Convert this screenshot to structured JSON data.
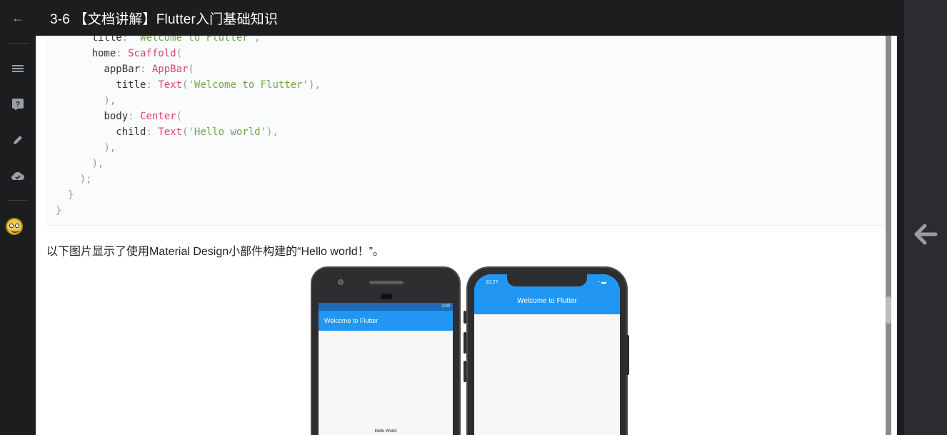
{
  "header": {
    "title": "3-6 【文档讲解】Flutter入门基础知识"
  },
  "left_rail": {
    "items": [
      {
        "name": "back-icon",
        "glyph": "←"
      },
      {
        "name": "menu-icon",
        "glyph": "≡"
      },
      {
        "name": "help-icon",
        "glyph": "?"
      },
      {
        "name": "edit-icon",
        "glyph": "✎"
      },
      {
        "name": "cloud-check-icon",
        "glyph": "☁"
      }
    ]
  },
  "code": {
    "lines": [
      {
        "indent": "      ",
        "key": "title",
        "colon": ": ",
        "str": "'Welcome to Flutter'",
        "tail": ","
      },
      {
        "indent": "      ",
        "key": "home",
        "colon": ": ",
        "type": "Scaffold",
        "tail": "("
      },
      {
        "indent": "        ",
        "key": "appBar",
        "colon": ": ",
        "type": "AppBar",
        "tail": "("
      },
      {
        "indent": "          ",
        "key": "title",
        "colon": ": ",
        "type": "Text",
        "open": "(",
        "str": "'Welcome to Flutter'",
        "tail": "),"
      },
      {
        "indent": "        ",
        "punct": "),"
      },
      {
        "indent": "        ",
        "key": "body",
        "colon": ": ",
        "type": "Center",
        "tail": "("
      },
      {
        "indent": "          ",
        "key": "child",
        "colon": ": ",
        "type": "Text",
        "open": "(",
        "str": "'Hello world'",
        "tail": "),"
      },
      {
        "indent": "        ",
        "punct": "),"
      },
      {
        "indent": "      ",
        "punct": "),"
      },
      {
        "indent": "    ",
        "punct": ");"
      },
      {
        "indent": "  ",
        "punct": "}"
      },
      {
        "indent": "",
        "punct": "}"
      }
    ]
  },
  "paragraph": "以下图片显示了使用Material Design小部件构建的“Hello world！”。",
  "phone_android": {
    "status_time": "1:00",
    "appbar_title": "Welcome to Flutter",
    "body_text": "Hello World"
  },
  "phone_ios": {
    "status_time": "10:27",
    "appbar_title": "Welcome to Flutter"
  },
  "colors": {
    "accent": "#2196f3",
    "code_type": "#e33e6e",
    "code_string": "#6fa74c"
  }
}
